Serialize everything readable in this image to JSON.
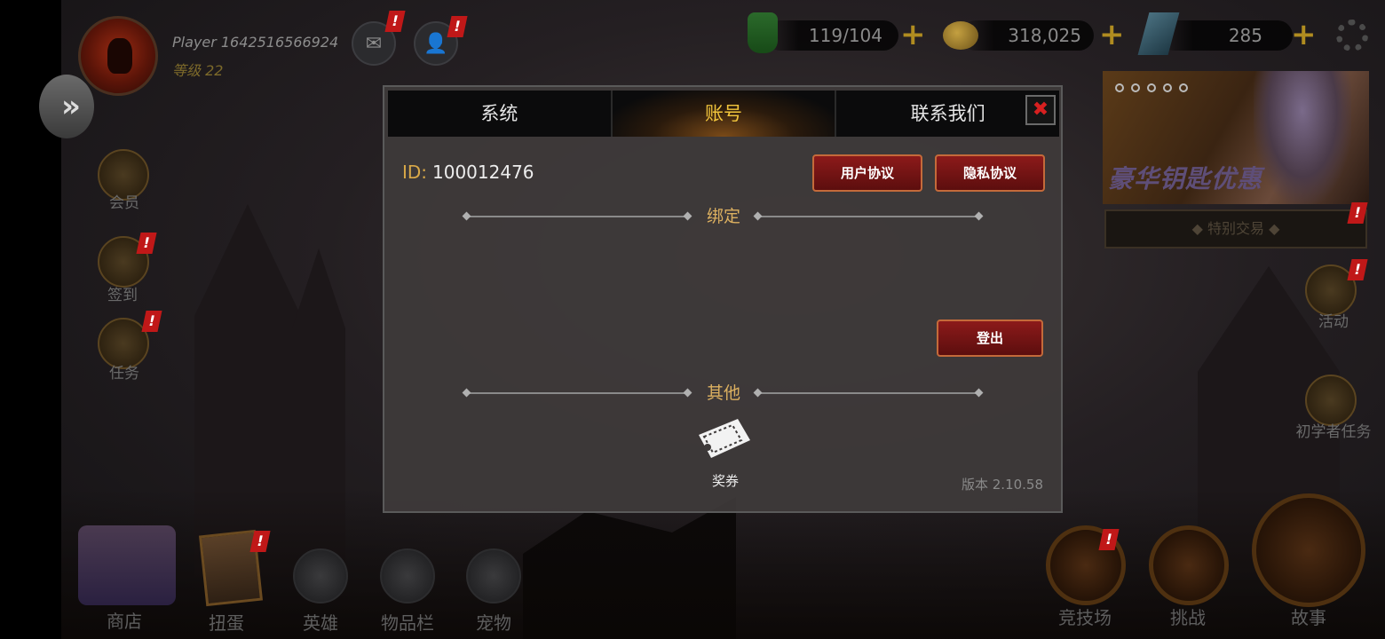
{
  "header": {
    "player_name": "Player 1642516566924",
    "level_label": "等级 22",
    "mail_badge": "!",
    "friends_badge": "!"
  },
  "resources": [
    {
      "name": "stamina",
      "icon": "potion-icon",
      "value": "119/104",
      "plus": "+"
    },
    {
      "name": "gold",
      "icon": "coins-icon",
      "value": "318,025",
      "plus": "+"
    },
    {
      "name": "crystals",
      "icon": "crystal-icon",
      "value": "285",
      "plus": "+"
    }
  ],
  "left_menu": [
    {
      "label": "会员",
      "badge": ""
    },
    {
      "label": "签到",
      "badge": "!"
    },
    {
      "label": "任务",
      "badge": "!"
    }
  ],
  "promo": {
    "title": "豪华钥匙优惠",
    "special_label": "◆ 特别交易 ◆",
    "badge": "!"
  },
  "right_menu": [
    {
      "label": "活动",
      "badge": "!"
    },
    {
      "label": "初学者任务",
      "badge": ""
    }
  ],
  "bottom_nav": [
    {
      "label": "商店"
    },
    {
      "label": "扭蛋",
      "badge": "!"
    },
    {
      "label": "英雄"
    },
    {
      "label": "物品栏"
    },
    {
      "label": "宠物"
    }
  ],
  "bottom_right": [
    {
      "label": "竞技场",
      "badge": "!"
    },
    {
      "label": "挑战"
    },
    {
      "label": "故事"
    }
  ],
  "modal": {
    "tabs": [
      "系统",
      "账号",
      "联系我们"
    ],
    "active_tab": "账号",
    "close_symbol": "✖",
    "id_label": "ID:",
    "id_value": "100012476",
    "user_agreement": "用户协议",
    "privacy_agreement": "隐私协议",
    "bind_section": "绑定",
    "logout": "登出",
    "other_section": "其他",
    "voucher_label": "奖券",
    "version": "版本 2.10.58"
  },
  "colors": {
    "accent_gold": "#f3c63c",
    "section_gold": "#dcb060",
    "button_red": "#8c1a1a",
    "alert_red": "#c01818"
  }
}
